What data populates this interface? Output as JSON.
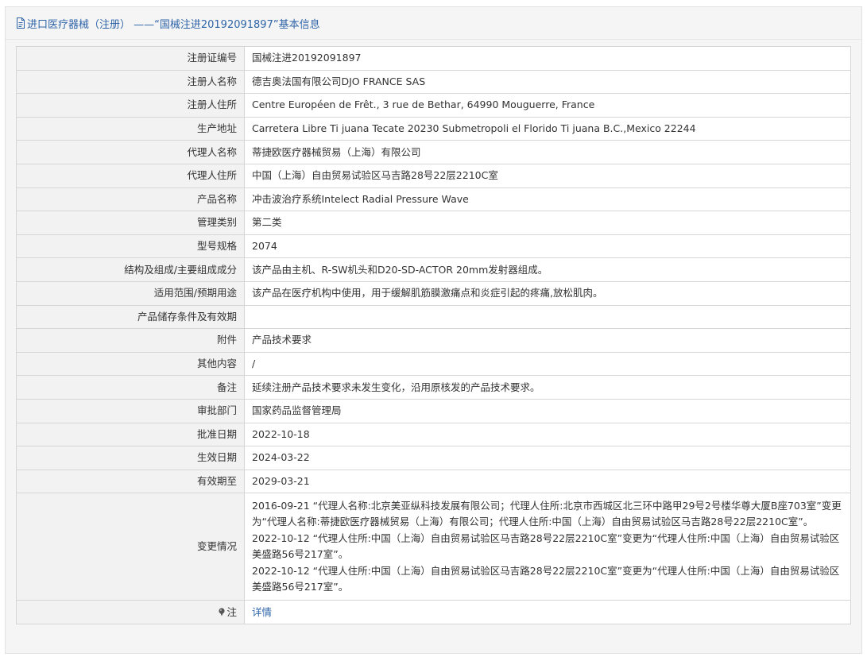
{
  "header": {
    "title": "进口医疗器械（注册） ——“国械注进20192091897”基本信息"
  },
  "rows": [
    {
      "label": "注册证编号",
      "value": "国械注进20192091897"
    },
    {
      "label": "注册人名称",
      "value": "德吉奥法国有限公司DJO FRANCE SAS"
    },
    {
      "label": "注册人住所",
      "value": "Centre Européen de Frêt., 3 rue de Bethar, 64990 Mouguerre, France"
    },
    {
      "label": "生产地址",
      "value": "Carretera Libre Ti juana Tecate 20230 Submetropoli el Florido Ti juana B.C.,Mexico 22244"
    },
    {
      "label": "代理人名称",
      "value": "蒂捷欧医疗器械贸易（上海）有限公司"
    },
    {
      "label": "代理人住所",
      "value": "中国（上海）自由贸易试验区马吉路28号22层2210C室"
    },
    {
      "label": "产品名称",
      "value": "冲击波治疗系统Intelect Radial Pressure Wave"
    },
    {
      "label": "管理类别",
      "value": "第二类"
    },
    {
      "label": "型号规格",
      "value": "2074"
    },
    {
      "label": "结构及组成/主要组成成分",
      "value": "该产品由主机、R-SW机头和D20-SD-ACTOR 20mm发射器组成。"
    },
    {
      "label": "适用范围/预期用途",
      "value": "该产品在医疗机构中使用，用于缓解肌筋膜激痛点和炎症引起的疼痛,放松肌肉。"
    },
    {
      "label": "产品储存条件及有效期",
      "value": ""
    },
    {
      "label": "附件",
      "value": "产品技术要求"
    },
    {
      "label": "其他内容",
      "value": "/"
    },
    {
      "label": "备注",
      "value": "延续注册产品技术要求未发生变化，沿用原核发的产品技术要求。"
    },
    {
      "label": "审批部门",
      "value": "国家药品监督管理局"
    },
    {
      "label": "批准日期",
      "value": "2022-10-18"
    },
    {
      "label": "生效日期",
      "value": "2024-03-22"
    },
    {
      "label": "有效期至",
      "value": "2029-03-21"
    }
  ],
  "changes": {
    "label": "变更情况",
    "entries": [
      "2016-09-21 “代理人名称:北京美亚纵科技发展有限公司；代理人住所:北京市西城区北三环中路甲29号2号楼华尊大厦B座703室”变更为“代理人名称:蒂捷欧医疗器械贸易（上海）有限公司；代理人住所:中国（上海）自由贸易试验区马吉路28号22层2210C室”。",
      "2022-10-12 “代理人住所:中国（上海）自由贸易试验区马吉路28号22层2210C室”变更为“代理人住所:中国（上海）自由贸易试验区美盛路56号217室”。",
      "2022-10-12 “代理人住所:中国（上海）自由贸易试验区马吉路28号22层2210C室”变更为“代理人住所:中国（上海）自由贸易试验区美盛路56号217室”。"
    ]
  },
  "note": {
    "label": "注",
    "link": "详情",
    "icon": "pin-icon"
  },
  "colors": {
    "accent": "#2e64a8",
    "label_bg": "#f2f2f2",
    "border": "#d6d6d6"
  }
}
